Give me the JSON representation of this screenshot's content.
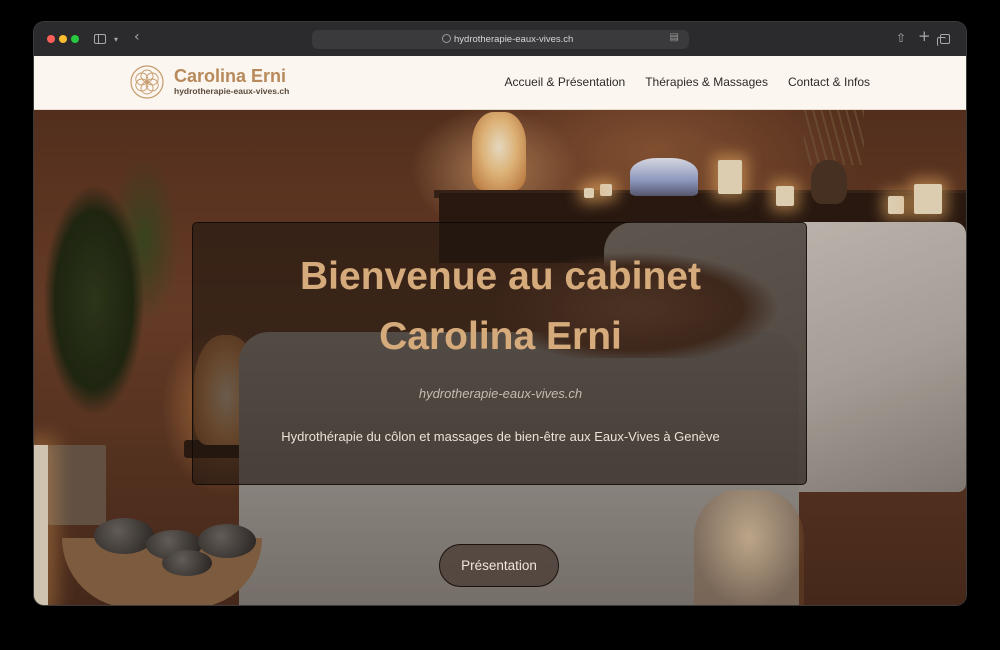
{
  "browser": {
    "url": "hydrotherapie-eaux-vives.ch"
  },
  "site": {
    "brand_name": "Carolina Erni",
    "brand_domain": "hydrotherapie-eaux-vives.ch",
    "accent_color": "#b8895a",
    "nav": [
      {
        "label": "Accueil & Présentation"
      },
      {
        "label": "Thérapies & Massages"
      },
      {
        "label": "Contact & Infos"
      }
    ]
  },
  "hero": {
    "title_line1": "Bienvenue au cabinet",
    "title_line2": "Carolina Erni",
    "domain": "hydrotherapie-eaux-vives.ch",
    "subtitle": "Hydrothérapie du côlon et massages de bien-être aux Eaux-Vives à Genève",
    "cta_label": "Présentation"
  }
}
